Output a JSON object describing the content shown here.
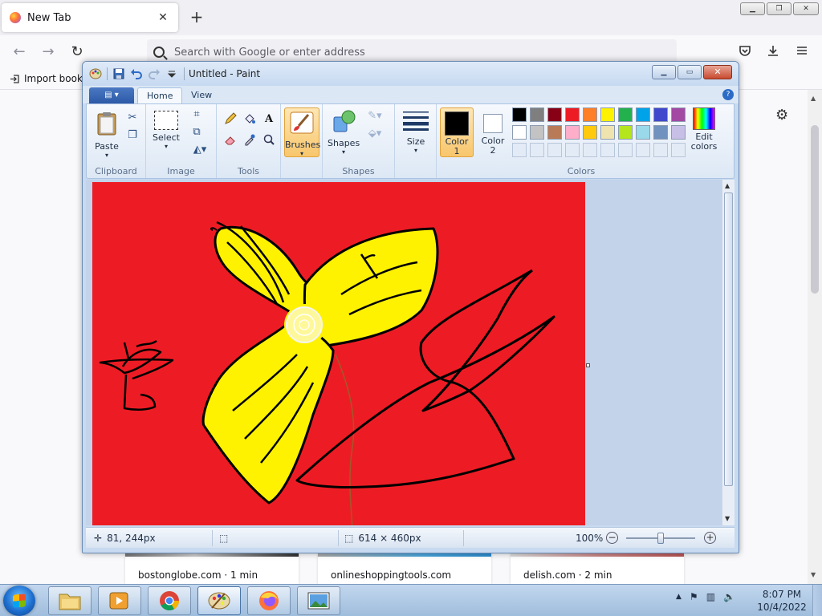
{
  "browser": {
    "tab_title": "New Tab",
    "tab_close": "✕",
    "new_tab": "+",
    "url_placeholder": "Search with Google or enter address",
    "bookmark_import": "Import bookm",
    "tiles": [
      {
        "label": "bostonglobe.com · 1 min"
      },
      {
        "label": "onlineshoppingtools.com"
      },
      {
        "label": "delish.com · 2 min"
      }
    ],
    "window_controls": {
      "minimize": "▁",
      "restore": "❐",
      "close": "✕"
    }
  },
  "paint": {
    "title": "Untitled - Paint",
    "tabs": {
      "file": "▤ ▾",
      "home": "Home",
      "view": "View"
    },
    "help": "?",
    "clipboard": {
      "paste": "Paste",
      "group": "Clipboard"
    },
    "image": {
      "select": "Select",
      "group": "Image"
    },
    "tools": {
      "group": "Tools"
    },
    "brushes": {
      "label": "Brushes"
    },
    "shapes": {
      "label": "Shapes",
      "group": "Shapes"
    },
    "size": {
      "label": "Size"
    },
    "colors": {
      "color1": "Color",
      "color1_num": "1",
      "color2": "Color",
      "color2_num": "2",
      "edit": "Edit",
      "edit2": "colors",
      "group": "Colors",
      "color1_value": "#000000",
      "color2_value": "#ffffff",
      "palette_row1": [
        "#000000",
        "#7f7f7f",
        "#880015",
        "#ed1c24",
        "#ff7f27",
        "#fff200",
        "#22b14c",
        "#00a2e8",
        "#3f48cc",
        "#a349a4"
      ],
      "palette_row2": [
        "#ffffff",
        "#c3c3c3",
        "#b97a57",
        "#ffaec9",
        "#ffc90e",
        "#efe4b0",
        "#b5e61d",
        "#99d9ea",
        "#7092be",
        "#c8bfe7"
      ]
    },
    "status": {
      "cursor": "81, 244px",
      "size": "614 × 460px",
      "zoom": "100%",
      "zoom_out": "−",
      "zoom_in": "+"
    },
    "canvas_color": "#ed1c24"
  },
  "taskbar": {
    "time": "8:07 PM",
    "date": "10/4/2022",
    "tray_arrow": "▲"
  }
}
